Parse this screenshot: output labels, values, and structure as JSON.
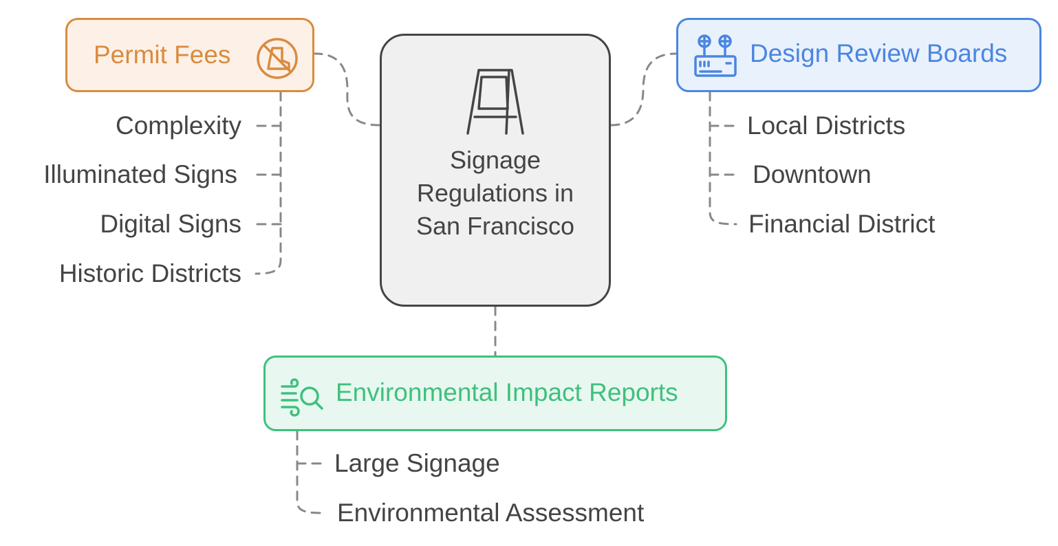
{
  "center": {
    "title": "Signage Regulations in San Francisco",
    "icon": "a-frame-sign-icon",
    "color": "#444444",
    "fill": "#f0f0f0"
  },
  "branches": {
    "permit_fees": {
      "label": "Permit Fees",
      "icon": "no-boot-icon",
      "color": "#d98b3f",
      "fill": "#fdf1e7",
      "items": [
        "Complexity",
        "Illuminated Signs",
        "Digital Signs",
        "Historic Districts"
      ]
    },
    "design_review": {
      "label": "Design Review Boards",
      "icon": "control-board-icon",
      "color": "#4a86df",
      "fill": "#e9f1fd",
      "items": [
        "Local Districts",
        "Downtown",
        "Financial District"
      ]
    },
    "environmental": {
      "label": "Environmental Impact Reports",
      "icon": "wind-search-icon",
      "color": "#3fc07e",
      "fill": "#e8f8f0",
      "items": [
        "Large Signage",
        "Environmental Assessment"
      ]
    }
  },
  "connector_color": "#888888"
}
